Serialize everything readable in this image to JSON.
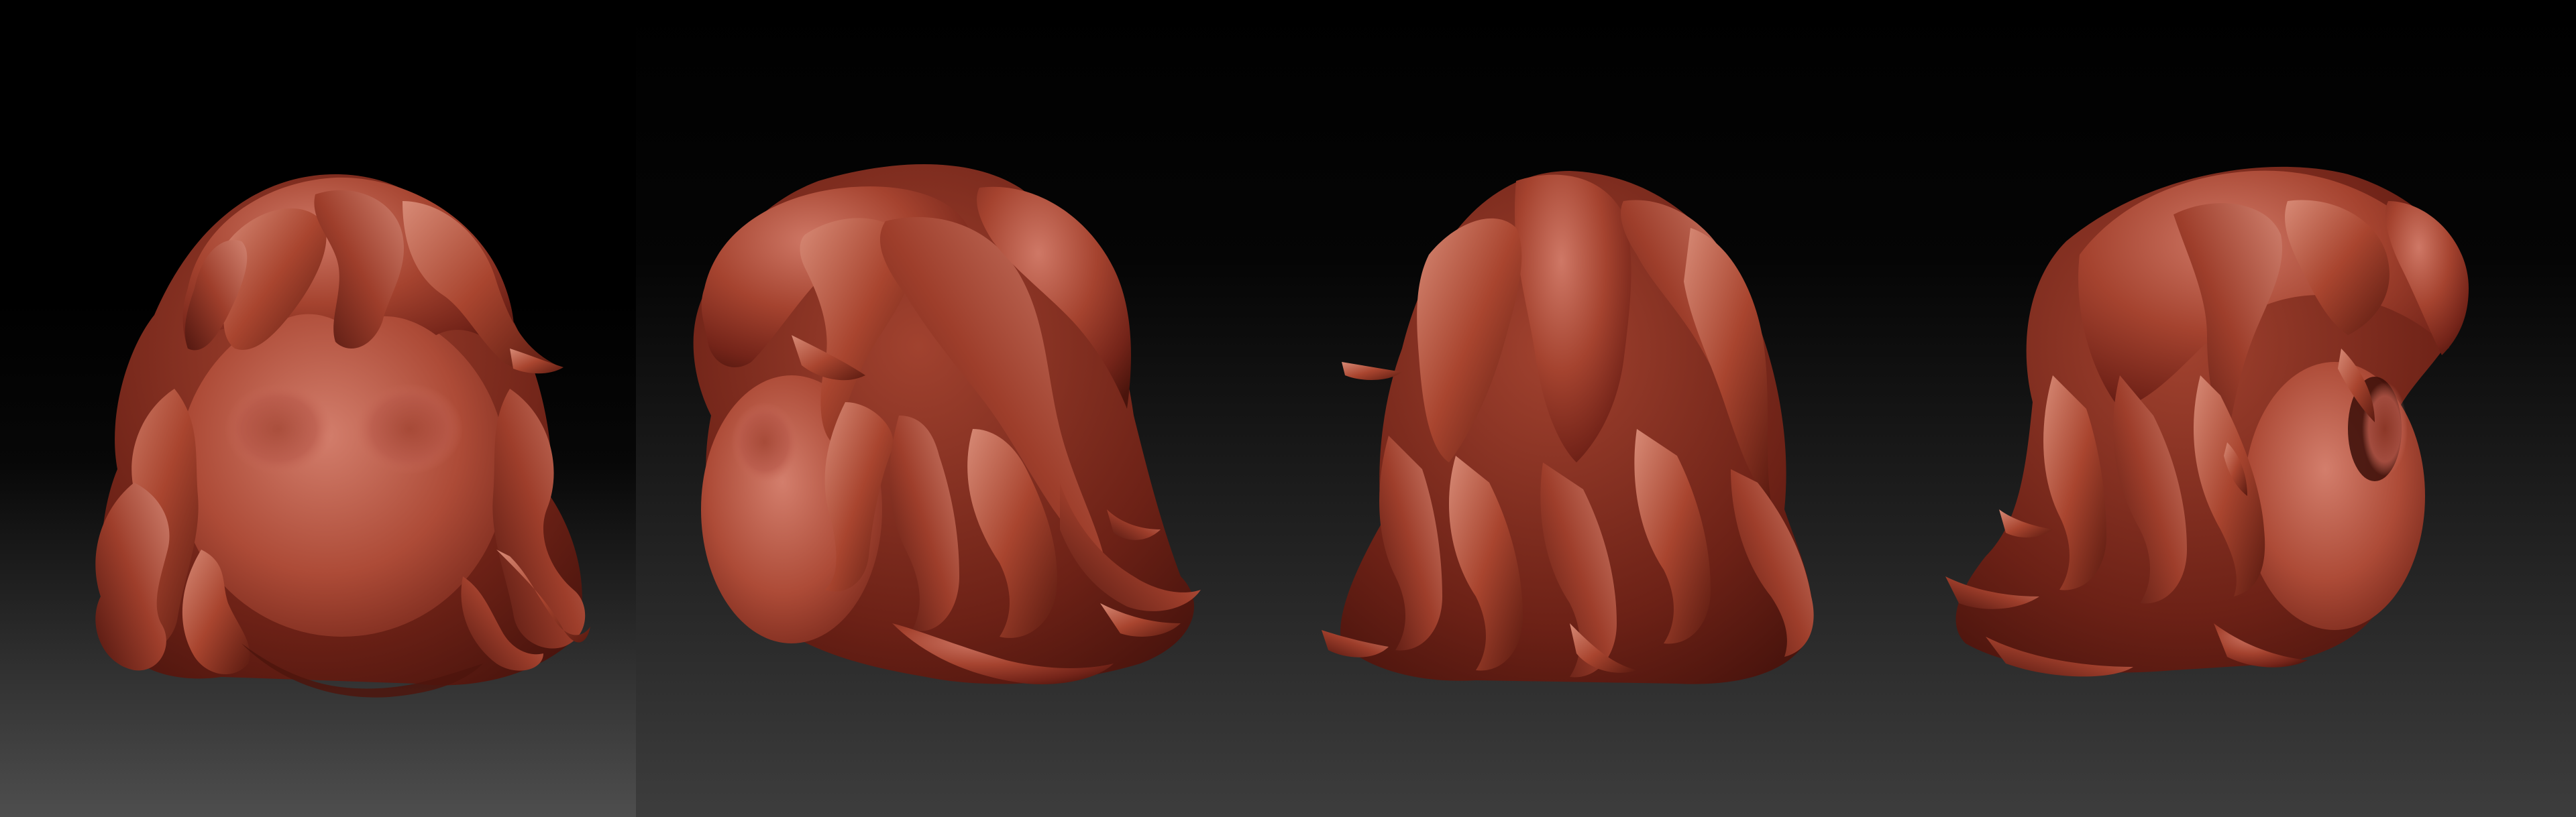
{
  "scene": {
    "views": [
      {
        "id": "front",
        "label": ""
      },
      {
        "id": "three-quarter-left",
        "label": ""
      },
      {
        "id": "back",
        "label": ""
      },
      {
        "id": "side-right",
        "label": ""
      }
    ]
  },
  "colors": {
    "background_top": "#000000",
    "background_bottom": "#3d3d3d",
    "left_panel_bottom": "#4e4e4e",
    "clay_base": "#9a3a2c",
    "clay_light": "#c46a58",
    "clay_highlight": "#e29a88",
    "clay_shadow": "#531710",
    "clay_deep_shadow": "#2e0b07"
  }
}
